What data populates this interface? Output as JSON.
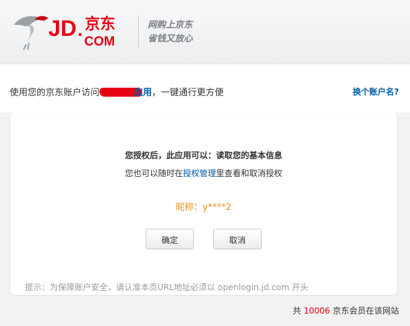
{
  "brand": {
    "logo_text": "JD.京东.COM",
    "slogan_line1": "网购上京东",
    "slogan_line2": "省钱又放心"
  },
  "intro": {
    "prefix": "使用您的京东账户访问",
    "app_name": "应用",
    "suffix": "，一键通行更方便",
    "switch_account": "换个账户名?"
  },
  "auth": {
    "permission_line": "您授权后，此应用可以：读取您的基本信息",
    "manage_prefix": "您也可以随时在",
    "manage_link": "授权管理",
    "manage_suffix": "里查看和取消授权",
    "nickname": "昵称：y****2",
    "confirm_label": "确定",
    "cancel_label": "取消",
    "hint": "提示：为保障账户安全，请认准本页URL地址必须以 openlogin.jd.com 开头"
  },
  "footer": {
    "prefix": "共 ",
    "member_count": "10006",
    "suffix": " 京东会员在该网站"
  },
  "colors": {
    "brand_red": "#e60012",
    "link_blue": "#005ea7",
    "nickname_orange": "#e8911a"
  }
}
